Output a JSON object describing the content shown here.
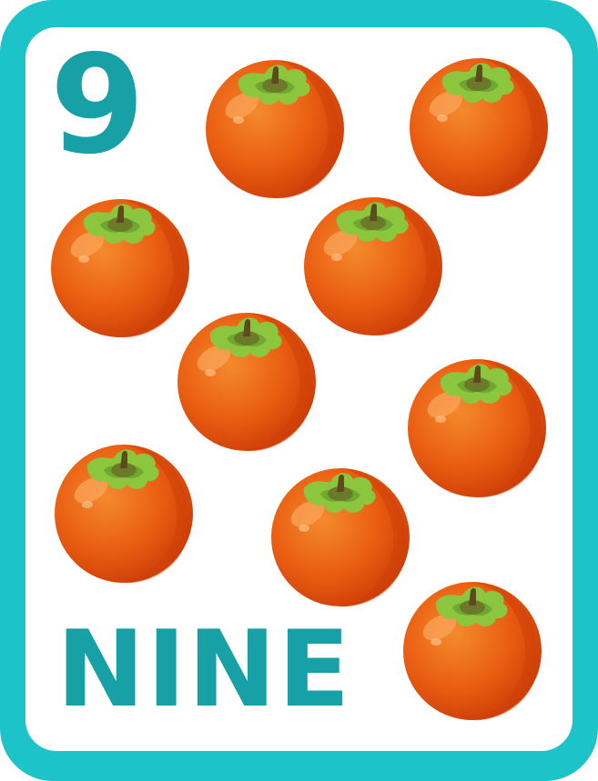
{
  "card": {
    "numeral": "9",
    "word": "NINE",
    "border_color": "#1CC3C8",
    "text_color": "#17A1A6"
  },
  "illustration": {
    "fruit_icon": "persimmon-icon",
    "fruit_count": 9,
    "fruit_color": "#E8580F",
    "leaf_color": "#8CC63E"
  }
}
